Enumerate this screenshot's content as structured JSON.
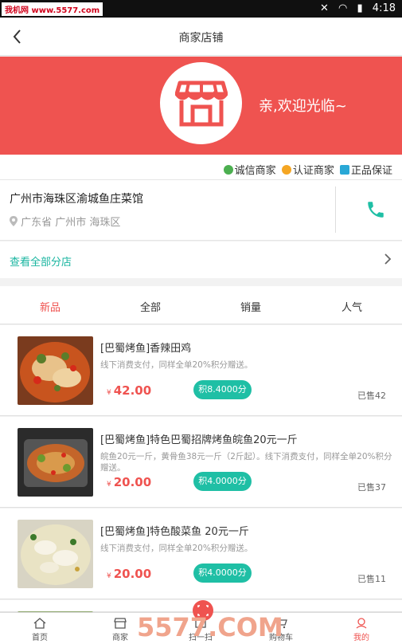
{
  "statusbar": {
    "watermark": "我机网 www.5577.com",
    "time": "4:18"
  },
  "header": {
    "title": "商家店铺",
    "back_icon": "back-arrow-icon"
  },
  "banner": {
    "welcome": "亲,欢迎光临~",
    "bg": "#ef5350",
    "icon": "store-icon"
  },
  "badges": [
    {
      "label": "诚信商家",
      "color": "#4caf50"
    },
    {
      "label": "认证商家",
      "color": "#f5a623"
    },
    {
      "label": "正品保证",
      "color": "#29a8d6"
    }
  ],
  "shop": {
    "name": "广州市海珠区渝城鱼庄菜馆",
    "address": "广东省 广州市 海珠区"
  },
  "all_stores": {
    "label": "查看全部分店"
  },
  "tabs": [
    {
      "label": "新品"
    },
    {
      "label": "全部"
    },
    {
      "label": "销量"
    },
    {
      "label": "人气"
    }
  ],
  "products": [
    {
      "name": "[巴蜀烤鱼]香辣田鸡",
      "desc": "线下消费支付，同样全单20%积分赠送。",
      "currency": "¥",
      "price": "42.00",
      "points": "积8.4000分",
      "sold": "已售42"
    },
    {
      "name": "[巴蜀烤鱼]特色巴蜀招牌烤鱼皖鱼20元一斤",
      "desc": "皖鱼20元一斤，黄骨鱼38元一斤（2斤起）。线下消费支付，同样全单20%积分赠送。",
      "currency": "¥",
      "price": "20.00",
      "points": "积4.0000分",
      "sold": "已售37"
    },
    {
      "name": "[巴蜀烤鱼]特色酸菜鱼 20元一斤",
      "desc": "线下消费支付，同样全单20%积分赠送。",
      "currency": "¥",
      "price": "20.00",
      "points": "积4.0000分",
      "sold": "已售11"
    }
  ],
  "tabbar": [
    {
      "label": "首页",
      "icon": "home-icon"
    },
    {
      "label": "商家",
      "icon": "shop-icon"
    },
    {
      "label": "扫一扫",
      "icon": "scan-icon"
    },
    {
      "label": "购物车",
      "icon": "cart-icon"
    },
    {
      "label": "我的",
      "icon": "user-icon"
    }
  ],
  "overlay_watermark": "5577.COM",
  "accent": "#ef5350",
  "teal": "#1fbfa5"
}
